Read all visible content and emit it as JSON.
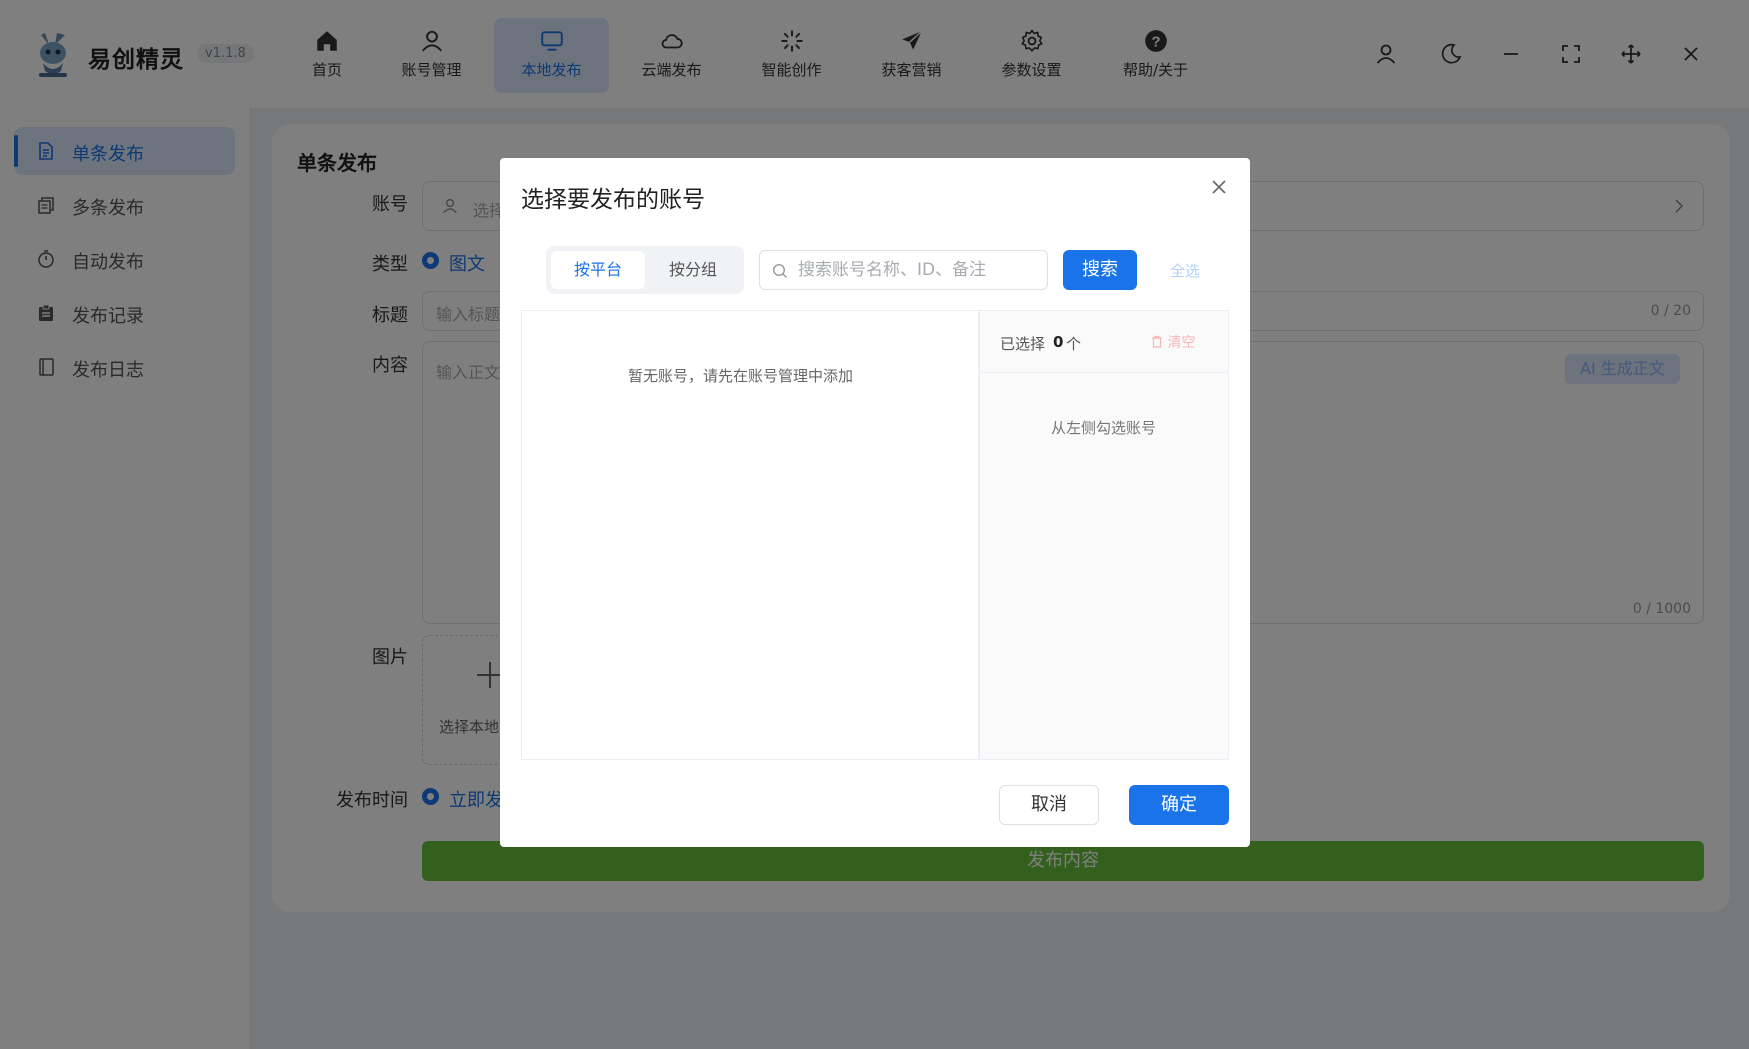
{
  "app": {
    "name": "易创精灵",
    "version": "v1.1.8"
  },
  "nav": [
    {
      "label": "首页",
      "icon": "home-icon"
    },
    {
      "label": "账号管理",
      "icon": "user-icon"
    },
    {
      "label": "本地发布",
      "icon": "monitor-icon",
      "active": true
    },
    {
      "label": "云端发布",
      "icon": "cloud-icon"
    },
    {
      "label": "智能创作",
      "icon": "spark-icon"
    },
    {
      "label": "获客营销",
      "icon": "send-icon"
    },
    {
      "label": "参数设置",
      "icon": "gear-icon"
    },
    {
      "label": "帮助/关于",
      "icon": "help-icon"
    }
  ],
  "sidebar": {
    "items": [
      {
        "label": "单条发布",
        "icon": "document-icon",
        "active": true
      },
      {
        "label": "多条发布",
        "icon": "copy-icon"
      },
      {
        "label": "自动发布",
        "icon": "timer-icon"
      },
      {
        "label": "发布记录",
        "icon": "clipboard-icon"
      },
      {
        "label": "发布日志",
        "icon": "book-icon"
      }
    ]
  },
  "form": {
    "title": "单条发布",
    "account_label": "账号",
    "account_placeholder": "选择",
    "type_label": "类型",
    "type_value": "图文",
    "title_label": "标题",
    "title_placeholder": "输入标题",
    "title_counter": "0 / 20",
    "content_label": "内容",
    "content_placeholder": "输入正文",
    "content_counter": "0 / 1000",
    "ai_button": "AI 生成正文",
    "image_label": "图片",
    "upload_text": "选择本地",
    "time_label": "发布时间",
    "time_value": "立即发",
    "publish_button": "发布内容"
  },
  "modal": {
    "title": "选择要发布的账号",
    "tabs": [
      "按平台",
      "按分组"
    ],
    "search_placeholder": "搜索账号名称、ID、备注",
    "search_button": "搜索",
    "select_all": "全选",
    "empty_text": "暂无账号，请先在账号管理中添加",
    "selected_label": "已选择",
    "selected_count": "0",
    "selected_unit": "个",
    "clear": "清空",
    "selected_empty": "从左侧勾选账号",
    "cancel": "取消",
    "confirm": "确定"
  },
  "colors": {
    "accent": "#1a73e8",
    "publish": "#67c23a"
  }
}
